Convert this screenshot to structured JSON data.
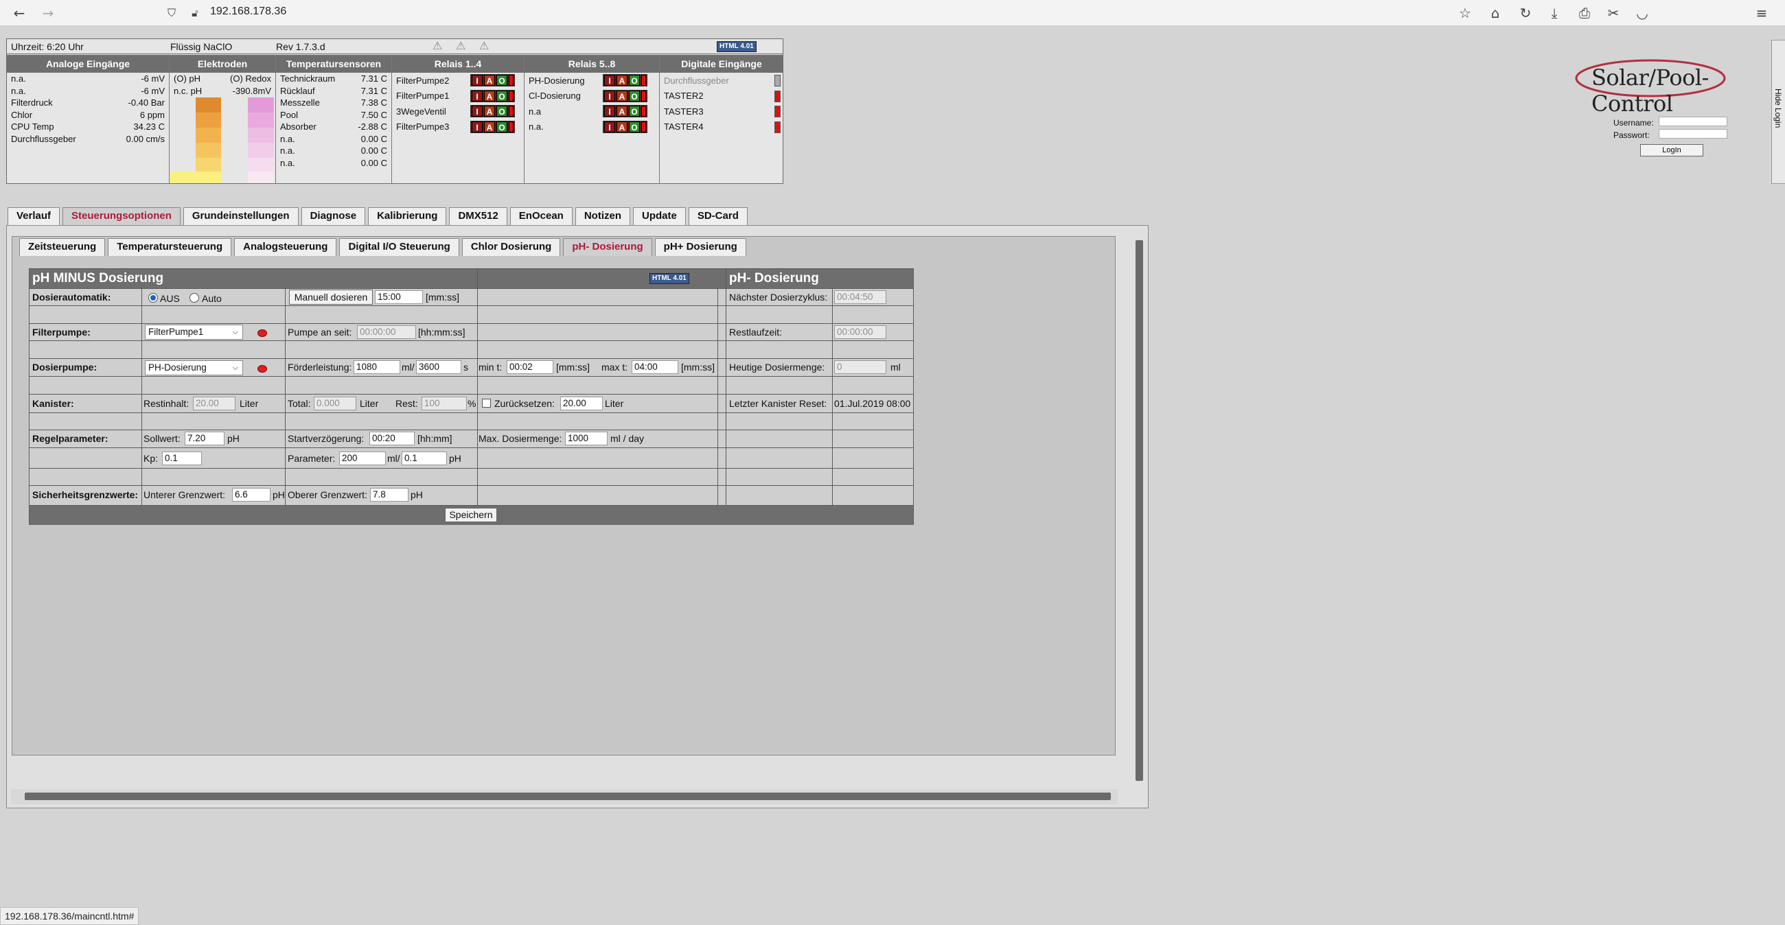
{
  "browser": {
    "url": "192.168.178.36",
    "status_url": "192.168.178.36/maincntl.htm#"
  },
  "info_top": {
    "time": "Uhrzeit: 6:20 Uhr",
    "product": "Flüssig NaClO",
    "rev": "Rev 1.7.3.d",
    "badge": "HTML 4.01"
  },
  "analog": {
    "title": "Analoge Eingänge",
    "rows": [
      {
        "label": "n.a.",
        "value": "-6 mV"
      },
      {
        "label": "n.a.",
        "value": "-6 mV"
      },
      {
        "label": "Filterdruck",
        "value": "-0.40 Bar"
      },
      {
        "label": "Chlor",
        "value": "6 ppm"
      },
      {
        "label": "CPU Temp",
        "value": "34.23 C"
      },
      {
        "label": "Durchflussgeber",
        "value": "0.00 cm/s"
      }
    ]
  },
  "electrodes": {
    "title": "Elektroden",
    "ph_label": "(O) pH",
    "ph_value": "n.c. pH",
    "redox_label": "(O) Redox",
    "redox_value": "-390.8mV"
  },
  "temps": {
    "title": "Temperatursensoren",
    "rows": [
      {
        "label": "Technickraum",
        "value": "7.31 C"
      },
      {
        "label": "Rücklauf",
        "value": "7.31 C"
      },
      {
        "label": "Messzelle",
        "value": "7.38 C"
      },
      {
        "label": "Pool",
        "value": "7.50 C"
      },
      {
        "label": "Absorber",
        "value": "-2.88 C"
      },
      {
        "label": "n.a.",
        "value": "0.00 C"
      },
      {
        "label": "n.a.",
        "value": "0.00 C"
      },
      {
        "label": "n.a.",
        "value": "0.00 C"
      }
    ]
  },
  "relays14": {
    "title": "Relais 1..4",
    "items": [
      "FilterPumpe2",
      "FilterPumpe1",
      "3WegeVentil",
      "FilterPumpe3"
    ]
  },
  "relays58": {
    "title": "Relais 5..8",
    "items": [
      "PH-Dosierung",
      "Cl-Dosierung",
      "n.a",
      "n.a."
    ]
  },
  "relay_buttons": {
    "i": "I",
    "a": "A",
    "o": "O"
  },
  "digital": {
    "title": "Digitale Eingänge",
    "items": [
      "Durchflussgeber",
      "TASTER2",
      "TASTER3",
      "TASTER4"
    ]
  },
  "logo": "Solar/Pool-Control",
  "login": {
    "username_label": "Username:",
    "password_label": "Passwort:",
    "button": "LogIn",
    "hide": "Hide Login"
  },
  "main_tabs": [
    "Verlauf",
    "Steuerungsoptionen",
    "Grundeinstellungen",
    "Diagnose",
    "Kalibrierung",
    "DMX512",
    "EnOcean",
    "Notizen",
    "Update",
    "SD-Card"
  ],
  "sub_tabs": [
    "Zeitsteuerung",
    "Temperatursteuerung",
    "Analogsteuerung",
    "Digital I/O Steuerung",
    "Chlor Dosierung",
    "pH- Dosierung",
    "pH+ Dosierung"
  ],
  "dosing": {
    "title": "pH MINUS Dosierung",
    "badge": "HTML 4.01",
    "right_title": "pH- Dosierung",
    "auto_label": "Dosierautomatik:",
    "aus": "AUS",
    "auto": "Auto",
    "manual_button": "Manuell dosieren",
    "manual_time": "15:00",
    "mmss": "[mm:ss]",
    "next_cycle_label": "Nächster Dosierzyklus:",
    "next_cycle": "00:04:50",
    "filter_label": "Filterpumpe:",
    "filter_select": "FilterPumpe1",
    "pump_on_label": "Pumpe an seit:",
    "pump_on": "00:00:00",
    "hhmmss": "[hh:mm:ss]",
    "remaining_label": "Restlaufzeit:",
    "remaining": "00:00:00",
    "doser_label": "Dosierpumpe:",
    "doser_select": "PH-Dosierung",
    "flow_label": "Förderleistung:",
    "flow_ml": "1080",
    "ml_slash": "ml/",
    "flow_s": "3600",
    "s": "s",
    "min_t_label": "min t:",
    "min_t": "00:02",
    "max_t_label": "max t:",
    "max_t": "04:00",
    "today_label": "Heutige Dosiermenge:",
    "today": "0",
    "ml": "ml",
    "canister_label": "Kanister:",
    "restinhalt_label": "Restinhalt:",
    "restinhalt": "20.00",
    "liter": "Liter",
    "total_label": "Total:",
    "total": "0.000",
    "rest_label": "Rest:",
    "rest": "100",
    "percent": "%",
    "reset_label": "Zurücksetzen:",
    "reset": "20.00",
    "last_reset_label": "Letzter Kanister Reset:",
    "last_reset": "01.Jul.2019 08:00",
    "reg_label": "Regelparameter:",
    "sollwert_label": "Sollwert:",
    "sollwert": "7.20",
    "ph": "pH",
    "start_delay_label": "Startverzögerung:",
    "start_delay": "00:20",
    "hhmm": "[hh:mm]",
    "max_dose_label": "Max. Dosiermenge:",
    "max_dose": "1000",
    "ml_day": "ml / day",
    "kp_label": "Kp:",
    "kp": "0.1",
    "param_label": "Parameter:",
    "param_ml": "200",
    "param_ph": "0.1",
    "safety_label": "Sicherheitsgrenzwerte:",
    "lower_label": "Unterer Grenzwert:",
    "lower": "6.6",
    "upper_label": "Oberer Grenzwert:",
    "upper": "7.8",
    "save": "Speichern"
  },
  "colors": {
    "active_tab": "#b0183a",
    "header_bg": "#6e6e6e",
    "relay_on": "#2f8a2f",
    "relay_red": "#dd1111"
  }
}
